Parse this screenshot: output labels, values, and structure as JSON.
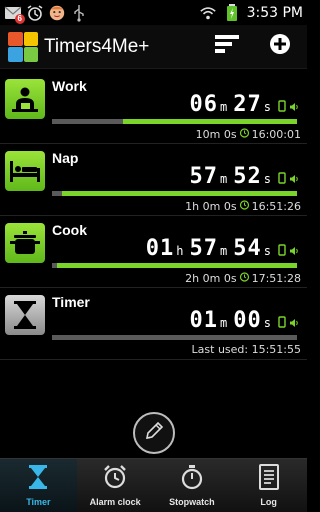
{
  "status_bar": {
    "time": "3:53 PM",
    "icons": [
      "mail-icon",
      "alarm-icon",
      "avatar-icon",
      "usb-icon",
      "wifi-icon",
      "battery-icon"
    ],
    "mail_badge": "6"
  },
  "header": {
    "title": "Timers4Me+",
    "icons": [
      "sort-icon",
      "add-icon"
    ]
  },
  "timers": [
    {
      "name": "Work",
      "icon": "worker-icon",
      "digits": [
        "06",
        "27"
      ],
      "units": [
        "m",
        "s"
      ],
      "detail": "10m 0s",
      "end_time": "16:00:01",
      "progress": 0.71,
      "active": true
    },
    {
      "name": "Nap",
      "icon": "bed-icon",
      "digits": [
        "57",
        "52"
      ],
      "units": [
        "m",
        "s"
      ],
      "detail": "1h 0m 0s",
      "end_time": "16:51:26",
      "progress": 0.96,
      "active": true
    },
    {
      "name": "Cook",
      "icon": "pot-icon",
      "digits": [
        "01",
        "57",
        "54"
      ],
      "units": [
        "h",
        "m",
        "s"
      ],
      "detail": "2h 0m 0s",
      "end_time": "17:51:28",
      "progress": 0.98,
      "active": true
    },
    {
      "name": "Timer",
      "icon": "hourglass-icon",
      "digits": [
        "01",
        "00"
      ],
      "units": [
        "m",
        "s"
      ],
      "detail": "Last used: 15:51:55",
      "end_time": "",
      "progress": 0,
      "active": false
    }
  ],
  "edit": {
    "icon": "pencil-icon"
  },
  "nav": [
    {
      "label": "Timer",
      "icon": "hourglass-icon",
      "active": true
    },
    {
      "label": "Alarm clock",
      "icon": "alarm-clock-icon",
      "active": false
    },
    {
      "label": "Stopwatch",
      "icon": "stopwatch-icon",
      "active": false
    },
    {
      "label": "Log",
      "icon": "log-icon",
      "active": false
    }
  ],
  "colors": {
    "accent_green": "#7ad42a",
    "bar_track": "#5a5a5a",
    "active_tab": "#39b7e8",
    "background": "#000000"
  }
}
